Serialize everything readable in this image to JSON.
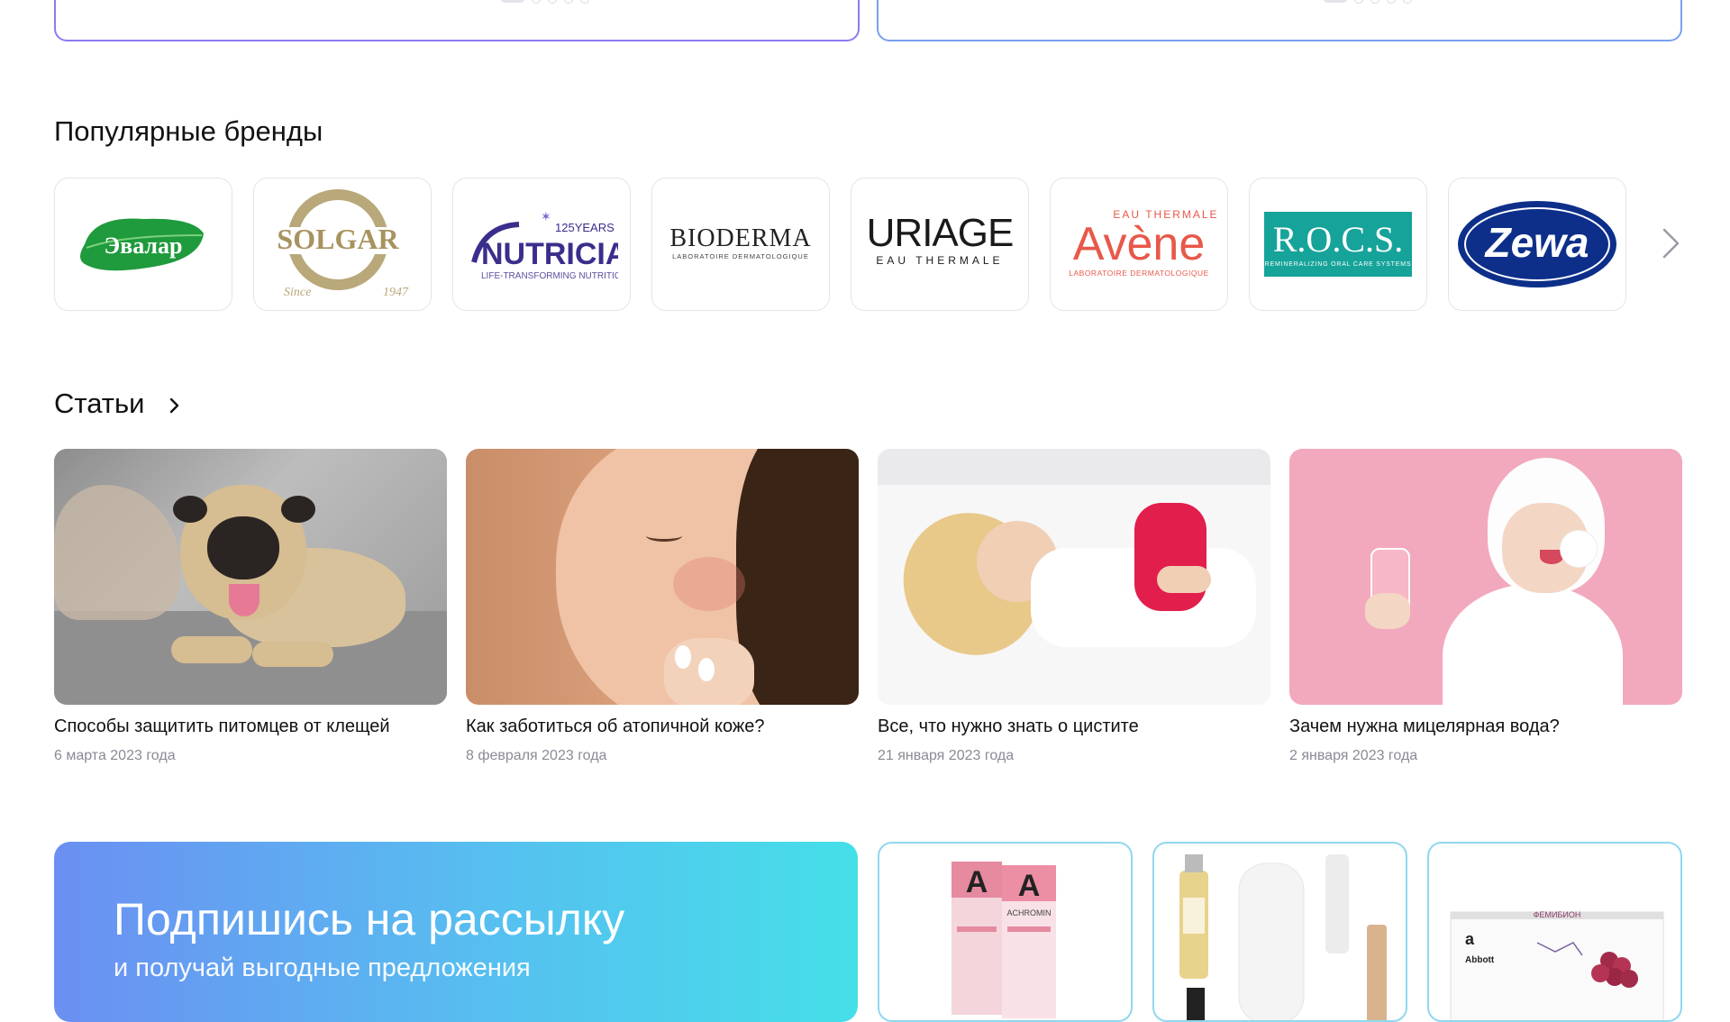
{
  "brands_section": {
    "title": "Популярные бренды",
    "items": [
      {
        "name": "Эвалар"
      },
      {
        "name": "Solgar"
      },
      {
        "name": "Nutricia"
      },
      {
        "name": "Bioderma"
      },
      {
        "name": "Uriage"
      },
      {
        "name": "Avène"
      },
      {
        "name": "R.O.C.S."
      },
      {
        "name": "Zewa"
      }
    ],
    "logo_text": {
      "evalar": "Эвалар",
      "solgar": "SOLGAR",
      "solgar_since": "Since",
      "solgar_year": "1947",
      "nutricia_years": "125YEARS",
      "nutricia": "NUTRICIA",
      "nutricia_tag": "LIFE-TRANSFORMING NUTRITION",
      "bioderma": "BIODERMA",
      "bioderma_tag": "LABORATOIRE DERMATOLOGIQUE",
      "uriage": "URIAGE",
      "uriage_tag": "EAU THERMALE",
      "avene_top": "EAU THERMALE",
      "avene": "Avène",
      "avene_tag": "LABORATOIRE DERMATOLOGIQUE",
      "rocs": "R.O.C.S.",
      "rocs_tag": "REMINERALIZING ORAL CARE SYSTEMS",
      "zewa": "Zewa"
    }
  },
  "articles_section": {
    "title": "Статьи",
    "items": [
      {
        "title": "Способы защитить питомцев от клещей",
        "date": "6 марта 2023 года"
      },
      {
        "title": "Как заботиться об атопичной коже?",
        "date": "8 февраля 2023 года"
      },
      {
        "title": "Все, что нужно знать о цистите",
        "date": "21 января 2023 года"
      },
      {
        "title": "Зачем нужна мицелярная вода?",
        "date": "2 января 2023 года"
      }
    ]
  },
  "subscribe": {
    "heading": "Подпишись на рассылку",
    "subheading": "и получай выгодные предложения"
  },
  "promos": {
    "achromin": "ACHROMIN",
    "abbott": "Abbott",
    "femibion": "ФЕМИБИОН"
  },
  "colors": {
    "brand_border": "#e4e4ea",
    "card_accent": "#8b7bf0",
    "subscribe_start": "#6b8ff2",
    "subscribe_end": "#45dfe8"
  }
}
